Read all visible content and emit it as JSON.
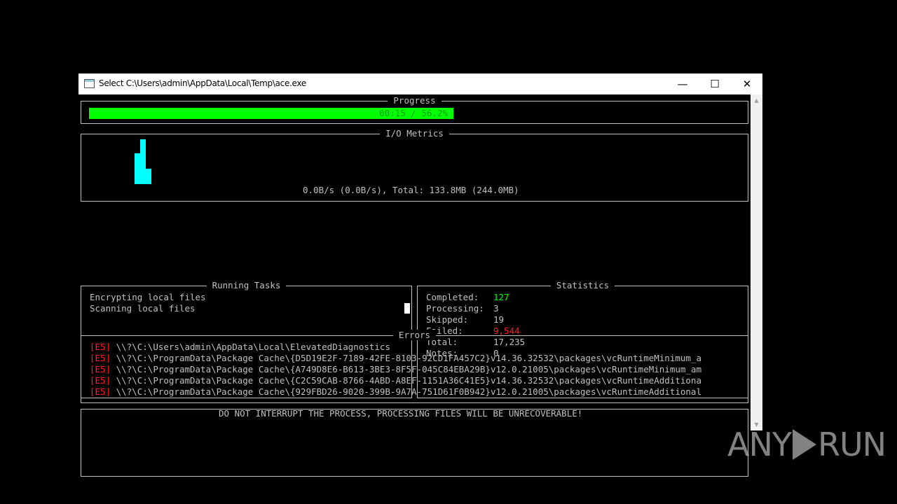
{
  "window": {
    "title": "Select C:\\Users\\admin\\AppData\\Local\\Temp\\ace.exe",
    "min_glyph": "—",
    "max_glyph": "☐",
    "close_glyph": "✕",
    "icon": "console-app-icon"
  },
  "progress": {
    "legend": "Progress",
    "text": "00:15 / 56.2%",
    "fraction": 0.562,
    "bar_color": "#00ff00"
  },
  "io": {
    "legend": "I/O Metrics",
    "summary": "0.0B/s (0.0B/s), Total: 133.8MB (244.0MB)",
    "spark_color": "#00ffff"
  },
  "tasks": {
    "legend": "Running Tasks",
    "items": [
      "Encrypting local files",
      "Scanning local files"
    ]
  },
  "stats": {
    "legend": "Statistics",
    "rows": [
      {
        "label": "Completed:",
        "value": "127"
      },
      {
        "label": "Processing:",
        "value": "3"
      },
      {
        "label": "Skipped:",
        "value": "19"
      },
      {
        "label": "Failed:",
        "value": "9,544"
      },
      {
        "label": "Total:",
        "value": "17,235"
      },
      {
        "label": "Notes:",
        "value": "0"
      }
    ],
    "colors": {
      "completed": "#00ff00",
      "failed": "#ff2020"
    }
  },
  "errors": {
    "legend": "Errors",
    "items": [
      {
        "code": "[E5]",
        "path": "\\\\?\\C:\\Users\\admin\\AppData\\Local\\ElevatedDiagnostics"
      },
      {
        "code": "[E5]",
        "path": "\\\\?\\C:\\ProgramData\\Package Cache\\{D5D19E2F-7189-42FE-8103-92CD1FA457C2}v14.36.32532\\packages\\vcRuntimeMinimum_a"
      },
      {
        "code": "[E5]",
        "path": "\\\\?\\C:\\ProgramData\\Package Cache\\{A749D8E6-B613-3BE3-8F5F-045C84EBA29B}v12.0.21005\\packages\\vcRuntimeMinimum_am"
      },
      {
        "code": "[E5]",
        "path": "\\\\?\\C:\\ProgramData\\Package Cache\\{C2C59CAB-8766-4ABD-A8EF-1151A36C41E5}v14.36.32532\\packages\\vcRuntimeAdditiona"
      },
      {
        "code": "[E5]",
        "path": "\\\\?\\C:\\ProgramData\\Package Cache\\{929FBD26-9020-399B-9A7A-751D61F0B942}v12.0.21005\\packages\\vcRuntimeAdditional"
      }
    ]
  },
  "warning": "DO NOT INTERRUPT THE PROCESS, PROCESSING FILES WILL BE UNRECOVERABLE!",
  "watermark": {
    "left": "ANY",
    "right": "RUN"
  }
}
